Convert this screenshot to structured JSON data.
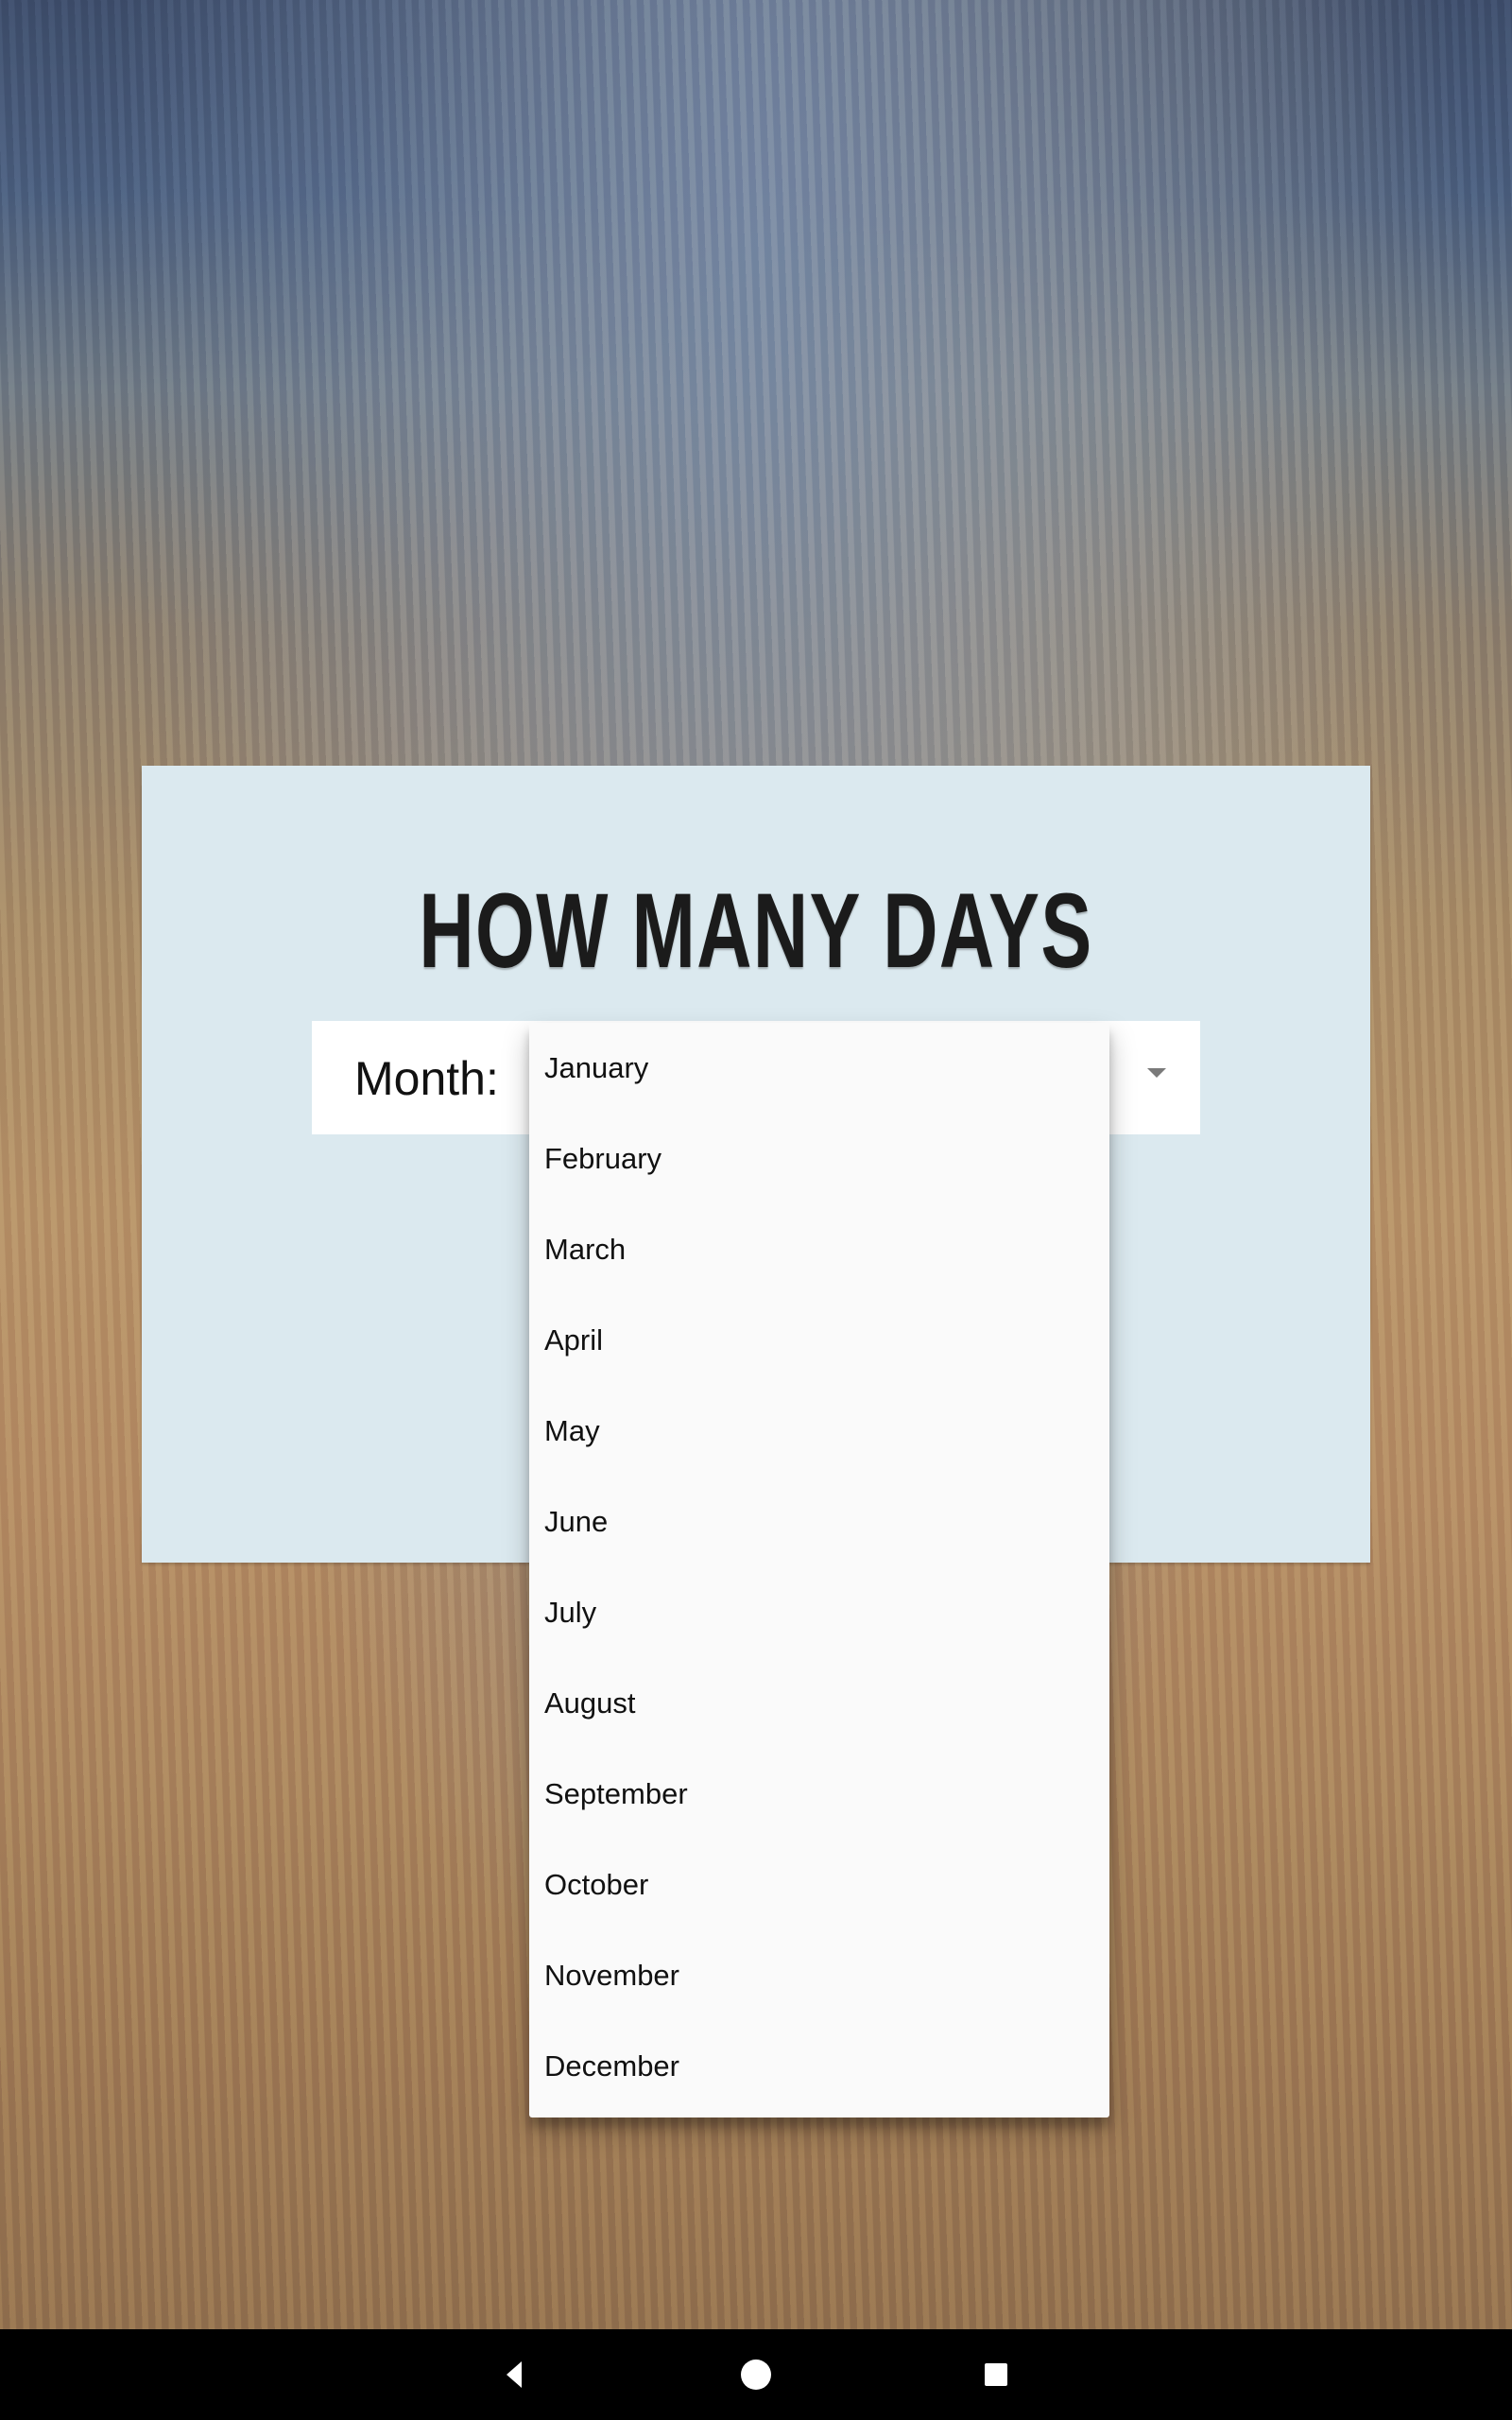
{
  "app": {
    "title": "HOW MANY DAYS"
  },
  "month_selector": {
    "label": "Month:",
    "options": [
      "January",
      "February",
      "March",
      "April",
      "May",
      "June",
      "July",
      "August",
      "September",
      "October",
      "November",
      "December"
    ]
  },
  "colors": {
    "card_bg": "#dbe9ef",
    "dropdown_bg": "#fafafa",
    "nav_bg": "#000000"
  },
  "icons": {
    "spinner": "chevron-down-icon",
    "back": "back-icon",
    "home": "home-icon",
    "recent": "recent-apps-icon"
  }
}
